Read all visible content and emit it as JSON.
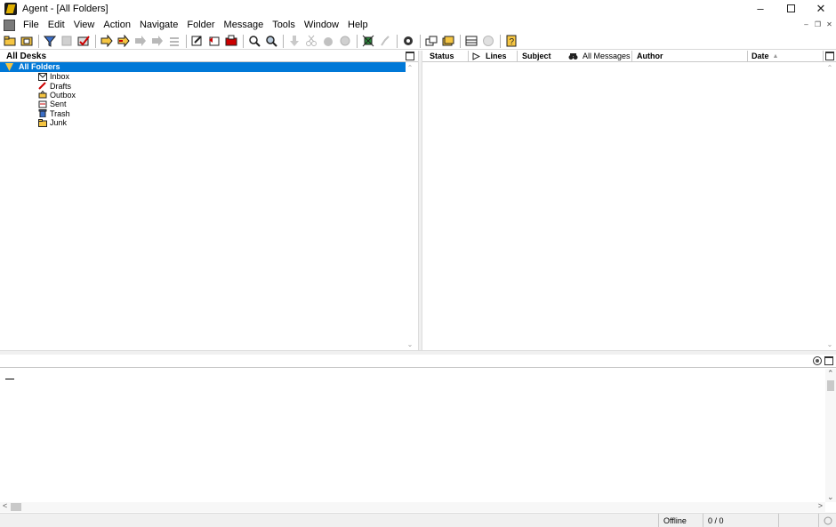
{
  "window": {
    "title": "Agent - [All Folders]",
    "controls": [
      "minimize-icon",
      "maximize-icon",
      "close-icon"
    ]
  },
  "menubar": {
    "items": [
      "File",
      "Edit",
      "View",
      "Action",
      "Navigate",
      "Folder",
      "Message",
      "Tools",
      "Window",
      "Help"
    ]
  },
  "left_pane": {
    "header": "All Desks",
    "root": "All Folders",
    "folders": [
      {
        "label": "Inbox",
        "icon": "envelope-icon"
      },
      {
        "label": "Drafts",
        "icon": "pencil-icon"
      },
      {
        "label": "Outbox",
        "icon": "outbox-icon"
      },
      {
        "label": "Sent",
        "icon": "sent-icon"
      },
      {
        "label": "Trash",
        "icon": "trash-icon"
      },
      {
        "label": "Junk",
        "icon": "junk-folder-icon"
      }
    ]
  },
  "right_pane": {
    "columns": [
      {
        "label": "Status"
      },
      {
        "label": "Lines"
      },
      {
        "label": "Subject"
      },
      {
        "label": "All Messages"
      },
      {
        "label": "Author"
      },
      {
        "label": "Date",
        "sort": "▲"
      }
    ]
  },
  "statusbar": {
    "mode": "Offline",
    "counts": "0 / 0"
  },
  "colors": {
    "selection": "#0078d7",
    "chrome": "#f0f0f0"
  }
}
